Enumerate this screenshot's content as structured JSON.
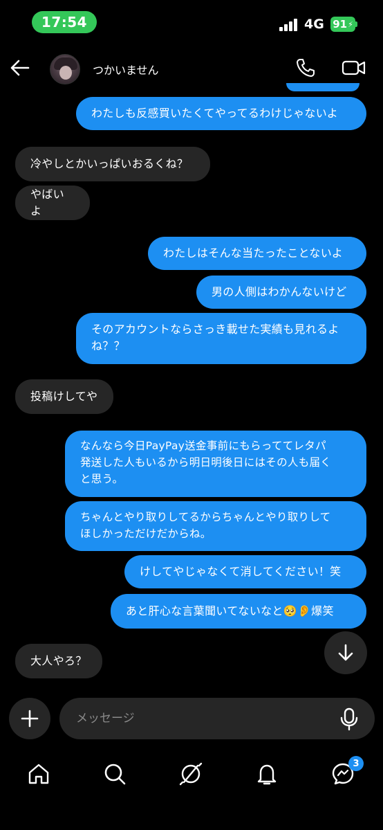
{
  "status_bar": {
    "time": "17:54",
    "network": "4G",
    "battery": "91",
    "accent_color": "#34c759"
  },
  "header": {
    "contact_name": "つかいません"
  },
  "messages": [
    {
      "side": "sent",
      "text": "わたしも反感買いたくてやってるわけじゃないよ"
    },
    {
      "side": "received",
      "text": "冷やしとかいっぱいおるくね？"
    },
    {
      "side": "received",
      "text": "やばいよ"
    },
    {
      "side": "sent",
      "text": "わたしはそんな当たったことないよ"
    },
    {
      "side": "sent",
      "text": "男の人側はわかんないけど"
    },
    {
      "side": "sent",
      "lines": [
        "そのアカウントならさっき載せた実績も見れるよ",
        "ね？？"
      ]
    },
    {
      "side": "received",
      "text": "投稿けしてや"
    },
    {
      "side": "sent",
      "lines": [
        "なんなら今日PayPay送金事前にもらっててレタパ",
        "発送した人もいるから明日明後日にはその人も届く",
        "と思う。"
      ]
    },
    {
      "side": "sent",
      "lines": [
        "ちゃんとやり取りしてるからちゃんとやり取りして",
        "ほしかっただけだからね。"
      ]
    },
    {
      "side": "sent",
      "text": "けしてやじゃなくて消してください！笑"
    },
    {
      "side": "sent",
      "text": "あと肝心な言葉聞いてないなと🥺👂爆笑"
    },
    {
      "side": "received",
      "text": "大人やろ？"
    }
  ],
  "composer": {
    "placeholder": "メッセージ"
  },
  "nav": {
    "items": [
      "home-icon",
      "search-icon",
      "explore-icon",
      "notifications-icon",
      "messages-icon"
    ],
    "messages_badge": "3"
  },
  "colors": {
    "sent_bubble": "#1d8ff2",
    "received_bubble": "#262626",
    "background": "#000000"
  }
}
